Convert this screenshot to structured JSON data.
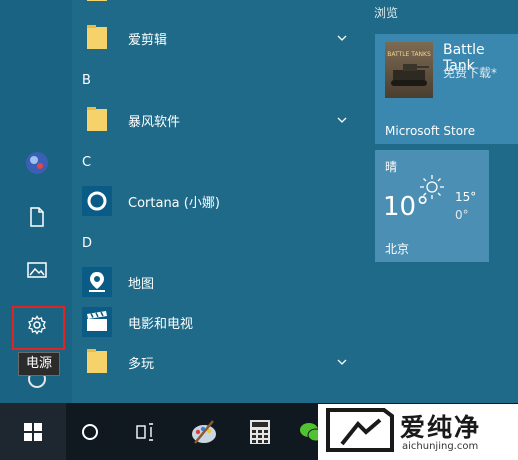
{
  "tooltip": {
    "text": "电源"
  },
  "app_groups": [
    {
      "header": null,
      "apps": [
        {
          "label": "爱剪辑",
          "type": "folder",
          "expand": true
        }
      ]
    },
    {
      "header": "B",
      "apps": [
        {
          "label": "暴风软件",
          "type": "folder",
          "expand": true
        }
      ]
    },
    {
      "header": "C",
      "apps": [
        {
          "label": "Cortana (小娜)",
          "type": "cortana",
          "expand": false
        }
      ]
    },
    {
      "header": "D",
      "apps": [
        {
          "label": "地图",
          "type": "maps",
          "expand": false
        },
        {
          "label": "电影和电视",
          "type": "movies",
          "expand": false
        },
        {
          "label": "多玩",
          "type": "folder",
          "expand": true
        }
      ]
    }
  ],
  "tiles": {
    "section_label": "浏览",
    "store": {
      "app_name": "Battle Tank",
      "app_sub": "免费下载*",
      "footer": "Microsoft Store",
      "thumb_text": "BATTLE TANKS"
    },
    "weather": {
      "condition": "晴",
      "temp": "10°",
      "high": "15°",
      "low": "0°",
      "city": "北京"
    }
  },
  "taskbar": {
    "icons": [
      "windows-start-icon",
      "cortana-circle-icon",
      "task-view-icon",
      "paint-icon",
      "calculator-icon",
      "wechat-icon"
    ]
  },
  "watermark": {
    "title": "爱纯净",
    "url": "aichunjing.com"
  },
  "colors": {
    "start_bg": "#1f6a88",
    "tile_bg": "#3a87b0",
    "highlight": "#e32222",
    "taskbar": "#101820"
  }
}
